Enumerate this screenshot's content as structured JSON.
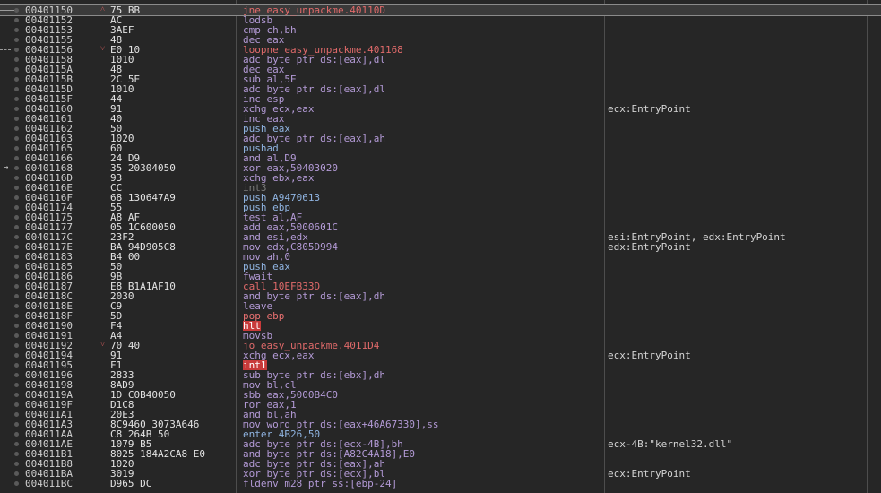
{
  "listing": {
    "rows": [
      {
        "addr": "00401150",
        "bytes": "75 BB",
        "instr": "jne easy_unpackme.40110D",
        "comment": "",
        "kind": "jmp",
        "gutter": "line-bp",
        "jmark": "˄",
        "selected": true
      },
      {
        "addr": "00401152",
        "bytes": "AC",
        "instr": "lodsb",
        "comment": "",
        "kind": "cmp",
        "gutter": "bp",
        "jmark": "",
        "selected": false
      },
      {
        "addr": "00401153",
        "bytes": "3AEF",
        "instr": "cmp ch,bh",
        "comment": "",
        "kind": "cmp",
        "gutter": "bp",
        "jmark": "",
        "selected": false
      },
      {
        "addr": "00401155",
        "bytes": "48",
        "instr": "dec eax",
        "comment": "",
        "kind": "cmp",
        "gutter": "bp",
        "jmark": "",
        "selected": false
      },
      {
        "addr": "00401156",
        "bytes": "E0 10",
        "instr": "loopne easy_unpackme.401168",
        "comment": "",
        "kind": "jmp",
        "gutter": "dash-bp",
        "jmark": "˅",
        "selected": false
      },
      {
        "addr": "00401158",
        "bytes": "1010",
        "instr": "adc byte ptr ds:[eax],dl",
        "comment": "",
        "kind": "sub",
        "gutter": "bp",
        "jmark": "",
        "selected": false
      },
      {
        "addr": "0040115A",
        "bytes": "48",
        "instr": "dec eax",
        "comment": "",
        "kind": "cmp",
        "gutter": "bp",
        "jmark": "",
        "selected": false
      },
      {
        "addr": "0040115B",
        "bytes": "2C 5E",
        "instr": "sub al,5E",
        "comment": "",
        "kind": "sub",
        "gutter": "bp",
        "jmark": "",
        "selected": false
      },
      {
        "addr": "0040115D",
        "bytes": "1010",
        "instr": "adc byte ptr ds:[eax],dl",
        "comment": "",
        "kind": "sub",
        "gutter": "bp",
        "jmark": "",
        "selected": false
      },
      {
        "addr": "0040115F",
        "bytes": "44",
        "instr": "inc esp",
        "comment": "",
        "kind": "cmp",
        "gutter": "bp",
        "jmark": "",
        "selected": false
      },
      {
        "addr": "00401160",
        "bytes": "91",
        "instr": "xchg ecx,eax",
        "comment": "ecx:EntryPoint",
        "kind": "cmp",
        "gutter": "bp",
        "jmark": "",
        "selected": false
      },
      {
        "addr": "00401161",
        "bytes": "40",
        "instr": "inc eax",
        "comment": "",
        "kind": "cmp",
        "gutter": "bp",
        "jmark": "",
        "selected": false
      },
      {
        "addr": "00401162",
        "bytes": "50",
        "instr": "push eax",
        "comment": "",
        "kind": "push",
        "gutter": "bp",
        "jmark": "",
        "selected": false
      },
      {
        "addr": "00401163",
        "bytes": "1020",
        "instr": "adc byte ptr ds:[eax],ah",
        "comment": "",
        "kind": "sub",
        "gutter": "bp",
        "jmark": "",
        "selected": false
      },
      {
        "addr": "00401165",
        "bytes": "60",
        "instr": "pushad",
        "comment": "",
        "kind": "push",
        "gutter": "bp",
        "jmark": "",
        "selected": false
      },
      {
        "addr": "00401166",
        "bytes": "24 D9",
        "instr": "and al,D9",
        "comment": "",
        "kind": "sub",
        "gutter": "bp",
        "jmark": "",
        "selected": false
      },
      {
        "addr": "00401168",
        "bytes": "35 20304050",
        "instr": "xor eax,50403020",
        "comment": "",
        "kind": "sub",
        "gutter": "arrow",
        "jmark": "",
        "selected": false
      },
      {
        "addr": "0040116D",
        "bytes": "93",
        "instr": "xchg ebx,eax",
        "comment": "",
        "kind": "cmp",
        "gutter": "bp",
        "jmark": "",
        "selected": false
      },
      {
        "addr": "0040116E",
        "bytes": "CC",
        "instr": "int3",
        "comment": "",
        "kind": "int3",
        "gutter": "bp",
        "jmark": "",
        "selected": false
      },
      {
        "addr": "0040116F",
        "bytes": "68 130647A9",
        "instr": "push A9470613",
        "comment": "",
        "kind": "push",
        "gutter": "bp",
        "jmark": "",
        "selected": false
      },
      {
        "addr": "00401174",
        "bytes": "55",
        "instr": "push ebp",
        "comment": "",
        "kind": "push",
        "gutter": "bp",
        "jmark": "",
        "selected": false
      },
      {
        "addr": "00401175",
        "bytes": "A8 AF",
        "instr": "test al,AF",
        "comment": "",
        "kind": "cmp",
        "gutter": "bp",
        "jmark": "",
        "selected": false
      },
      {
        "addr": "00401177",
        "bytes": "05 1C600050",
        "instr": "add eax,5000601C",
        "comment": "",
        "kind": "sub",
        "gutter": "bp",
        "jmark": "",
        "selected": false
      },
      {
        "addr": "0040117C",
        "bytes": "23F2",
        "instr": "and esi,edx",
        "comment": "esi:EntryPoint, edx:EntryPoint",
        "kind": "sub",
        "gutter": "bp",
        "jmark": "",
        "selected": false
      },
      {
        "addr": "0040117E",
        "bytes": "BA 94D905C8",
        "instr": "mov edx,C805D994",
        "comment": "edx:EntryPoint",
        "kind": "sub",
        "gutter": "bp",
        "jmark": "",
        "selected": false
      },
      {
        "addr": "00401183",
        "bytes": "B4 00",
        "instr": "mov ah,0",
        "comment": "",
        "kind": "sub",
        "gutter": "bp",
        "jmark": "",
        "selected": false
      },
      {
        "addr": "00401185",
        "bytes": "50",
        "instr": "push eax",
        "comment": "",
        "kind": "push",
        "gutter": "bp",
        "jmark": "",
        "selected": false
      },
      {
        "addr": "00401186",
        "bytes": "9B",
        "instr": "fwait",
        "comment": "",
        "kind": "cmp",
        "gutter": "bp",
        "jmark": "",
        "selected": false
      },
      {
        "addr": "00401187",
        "bytes": "E8 B1A1AF10",
        "instr": "call 10EFB33D",
        "comment": "",
        "kind": "call",
        "gutter": "bp",
        "jmark": "",
        "selected": false
      },
      {
        "addr": "0040118C",
        "bytes": "2030",
        "instr": "and byte ptr ds:[eax],dh",
        "comment": "",
        "kind": "sub",
        "gutter": "bp",
        "jmark": "",
        "selected": false
      },
      {
        "addr": "0040118E",
        "bytes": "C9",
        "instr": "leave",
        "comment": "",
        "kind": "cmp",
        "gutter": "bp",
        "jmark": "",
        "selected": false
      },
      {
        "addr": "0040118F",
        "bytes": "5D",
        "instr": "pop ebp",
        "comment": "",
        "kind": "ret",
        "gutter": "bp",
        "jmark": "",
        "selected": false
      },
      {
        "addr": "00401190",
        "bytes": "F4",
        "instr": "hlt",
        "comment": "",
        "kind": "halt",
        "gutter": "bp",
        "jmark": "",
        "selected": false
      },
      {
        "addr": "00401191",
        "bytes": "A4",
        "instr": "movsb",
        "comment": "",
        "kind": "cmp",
        "gutter": "bp",
        "jmark": "",
        "selected": false
      },
      {
        "addr": "00401192",
        "bytes": "70 40",
        "instr": "jo easy_unpackme.4011D4",
        "comment": "",
        "kind": "jmp",
        "gutter": "bp",
        "jmark": "˅",
        "selected": false
      },
      {
        "addr": "00401194",
        "bytes": "91",
        "instr": "xchg ecx,eax",
        "comment": "ecx:EntryPoint",
        "kind": "cmp",
        "gutter": "bp",
        "jmark": "",
        "selected": false
      },
      {
        "addr": "00401195",
        "bytes": "F1",
        "instr": "int1",
        "comment": "",
        "kind": "halt",
        "gutter": "bp",
        "jmark": "",
        "selected": false
      },
      {
        "addr": "00401196",
        "bytes": "2833",
        "instr": "sub byte ptr ds:[ebx],dh",
        "comment": "",
        "kind": "sub",
        "gutter": "bp",
        "jmark": "",
        "selected": false
      },
      {
        "addr": "00401198",
        "bytes": "8AD9",
        "instr": "mov bl,cl",
        "comment": "",
        "kind": "sub",
        "gutter": "bp",
        "jmark": "",
        "selected": false
      },
      {
        "addr": "0040119A",
        "bytes": "1D C0B40050",
        "instr": "sbb eax,5000B4C0",
        "comment": "",
        "kind": "sub",
        "gutter": "bp",
        "jmark": "",
        "selected": false
      },
      {
        "addr": "0040119F",
        "bytes": "D1C8",
        "instr": "ror eax,1",
        "comment": "",
        "kind": "sub",
        "gutter": "bp",
        "jmark": "",
        "selected": false
      },
      {
        "addr": "004011A1",
        "bytes": "20E3",
        "instr": "and bl,ah",
        "comment": "",
        "kind": "sub",
        "gutter": "bp",
        "jmark": "",
        "selected": false
      },
      {
        "addr": "004011A3",
        "bytes": "8C9460 3073A646",
        "instr": "mov word ptr ds:[eax+46A67330],ss",
        "comment": "",
        "kind": "sub",
        "gutter": "bp",
        "jmark": "",
        "selected": false
      },
      {
        "addr": "004011AA",
        "bytes": "C8 264B 50",
        "instr": "enter 4B26,50",
        "comment": "",
        "kind": "push",
        "gutter": "bp",
        "jmark": "",
        "selected": false
      },
      {
        "addr": "004011AE",
        "bytes": "1079 B5",
        "instr": "adc byte ptr ds:[ecx-4B],bh",
        "comment": "ecx-4B:\"kernel32.dll\"",
        "kind": "sub",
        "gutter": "bp",
        "jmark": "",
        "selected": false
      },
      {
        "addr": "004011B1",
        "bytes": "8025 184A2CA8 E0",
        "instr": "and byte ptr ds:[A82C4A18],E0",
        "comment": "",
        "kind": "sub",
        "gutter": "bp",
        "jmark": "",
        "selected": false
      },
      {
        "addr": "004011B8",
        "bytes": "1020",
        "instr": "adc byte ptr ds:[eax],ah",
        "comment": "",
        "kind": "sub",
        "gutter": "bp",
        "jmark": "",
        "selected": false
      },
      {
        "addr": "004011BA",
        "bytes": "3019",
        "instr": "xor byte ptr ds:[ecx],bl",
        "comment": "ecx:EntryPoint",
        "kind": "sub",
        "gutter": "bp",
        "jmark": "",
        "selected": false
      },
      {
        "addr": "004011BC",
        "bytes": "D965 DC",
        "instr": "fldenv m28 ptr ss:[ebp-24]",
        "comment": "",
        "kind": "cmp",
        "gutter": "bp",
        "jmark": "",
        "selected": false
      }
    ]
  }
}
